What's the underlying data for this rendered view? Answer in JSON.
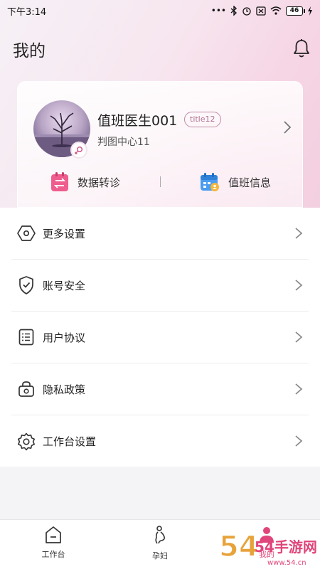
{
  "status_bar": {
    "time": "下午3:14",
    "battery": "46"
  },
  "header": {
    "title": "我的"
  },
  "profile": {
    "name": "值班医生001",
    "title_badge": "title12",
    "center": "判图中心11"
  },
  "actions": [
    {
      "label": "数据转诊",
      "icon": "transfer-icon"
    },
    {
      "label": "值班信息",
      "icon": "calendar-icon"
    }
  ],
  "menu": [
    {
      "label": "更多设置",
      "icon": "hexagon-settings-icon"
    },
    {
      "label": "账号安全",
      "icon": "shield-check-icon"
    },
    {
      "label": "用户协议",
      "icon": "list-document-icon"
    },
    {
      "label": "隐私政策",
      "icon": "lock-bag-icon"
    },
    {
      "label": "工作台设置",
      "icon": "gear-icon"
    }
  ],
  "tabbar": [
    {
      "label": "工作台",
      "icon": "home-icon"
    },
    {
      "label": "孕妇",
      "icon": "pregnant-icon"
    },
    {
      "label": "我的",
      "icon": "user-icon"
    }
  ],
  "watermark": {
    "text": "54手游网",
    "url": "www.54.cn"
  },
  "colors": {
    "accent": "#e0457b",
    "badge": "#c18aa4"
  }
}
